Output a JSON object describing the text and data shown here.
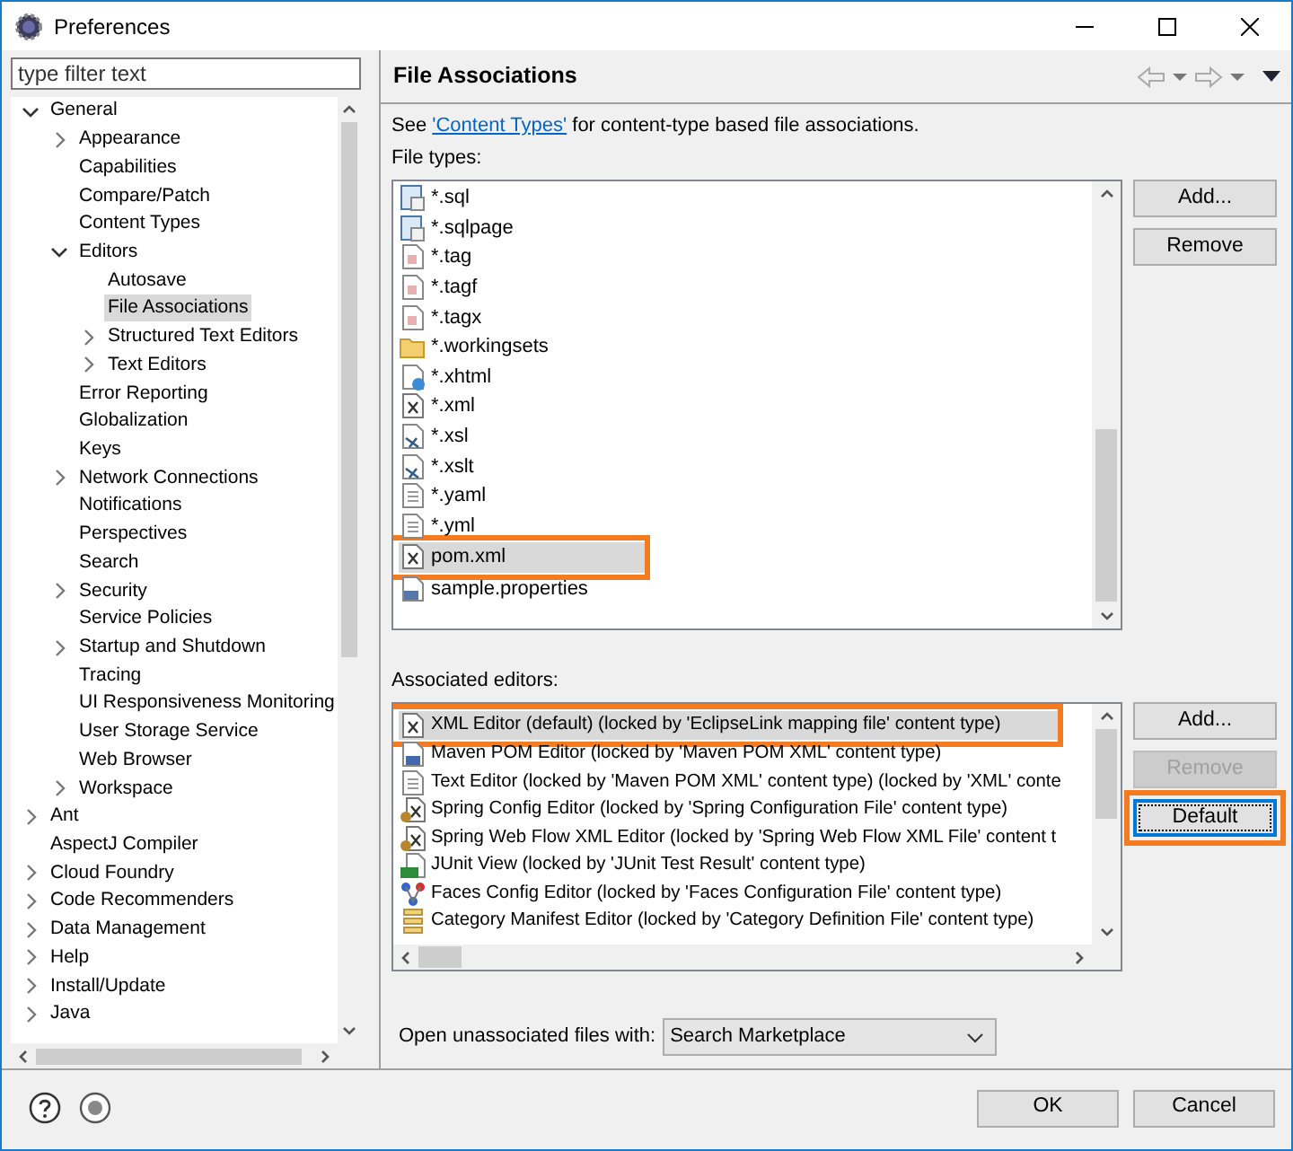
{
  "window": {
    "title": "Preferences"
  },
  "filter": {
    "placeholder": "type filter text"
  },
  "tree": [
    {
      "label": "General",
      "expanded": true,
      "selected": false,
      "children": [
        {
          "label": "Appearance",
          "expanded": false,
          "selected": false
        },
        {
          "label": "Capabilities",
          "selected": false
        },
        {
          "label": "Compare/Patch",
          "selected": false
        },
        {
          "label": "Content Types",
          "selected": false
        },
        {
          "label": "Editors",
          "expanded": true,
          "selected": false,
          "children": [
            {
              "label": "Autosave",
              "selected": false
            },
            {
              "label": "File Associations",
              "selected": true
            },
            {
              "label": "Structured Text Editors",
              "expanded": false,
              "selected": false
            },
            {
              "label": "Text Editors",
              "expanded": false,
              "selected": false
            }
          ]
        },
        {
          "label": "Error Reporting",
          "selected": false
        },
        {
          "label": "Globalization",
          "selected": false
        },
        {
          "label": "Keys",
          "selected": false
        },
        {
          "label": "Network Connections",
          "expanded": false,
          "selected": false
        },
        {
          "label": "Notifications",
          "selected": false
        },
        {
          "label": "Perspectives",
          "selected": false
        },
        {
          "label": "Search",
          "selected": false
        },
        {
          "label": "Security",
          "expanded": false,
          "selected": false
        },
        {
          "label": "Service Policies",
          "selected": false
        },
        {
          "label": "Startup and Shutdown",
          "expanded": false,
          "selected": false
        },
        {
          "label": "Tracing",
          "selected": false
        },
        {
          "label": "UI Responsiveness Monitoring",
          "selected": false
        },
        {
          "label": "User Storage Service",
          "selected": false
        },
        {
          "label": "Web Browser",
          "selected": false
        },
        {
          "label": "Workspace",
          "expanded": false,
          "selected": false
        }
      ]
    },
    {
      "label": "Ant",
      "expanded": false,
      "selected": false
    },
    {
      "label": "AspectJ Compiler",
      "selected": false
    },
    {
      "label": "Cloud Foundry",
      "expanded": false,
      "selected": false
    },
    {
      "label": "Code Recommenders",
      "expanded": false,
      "selected": false
    },
    {
      "label": "Data Management",
      "expanded": false,
      "selected": false
    },
    {
      "label": "Help",
      "expanded": false,
      "selected": false
    },
    {
      "label": "Install/Update",
      "expanded": false,
      "selected": false
    },
    {
      "label": "Java",
      "expanded": false,
      "selected": false
    }
  ],
  "page": {
    "title": "File Associations",
    "intro": {
      "before": "See ",
      "link": "'Content Types'",
      "after": " for content-type based file associations."
    },
    "file_types": {
      "label": "File types:",
      "items": [
        {
          "label": "*.sql",
          "kind": "sql",
          "selected": false,
          "annotated": false
        },
        {
          "label": "*.sqlpage",
          "kind": "sql",
          "selected": false,
          "annotated": false
        },
        {
          "label": "*.tag",
          "kind": "tag",
          "selected": false,
          "annotated": false
        },
        {
          "label": "*.tagf",
          "kind": "tag",
          "selected": false,
          "annotated": false
        },
        {
          "label": "*.tagx",
          "kind": "tag",
          "selected": false,
          "annotated": false
        },
        {
          "label": "*.workingsets",
          "kind": "folder",
          "selected": false,
          "annotated": false
        },
        {
          "label": "*.xhtml",
          "kind": "web",
          "selected": false,
          "annotated": false
        },
        {
          "label": "*.xml",
          "kind": "xml",
          "selected": false,
          "annotated": false
        },
        {
          "label": "*.xsl",
          "kind": "xsl",
          "selected": false,
          "annotated": false
        },
        {
          "label": "*.xslt",
          "kind": "xsl",
          "selected": false,
          "annotated": false
        },
        {
          "label": "*.yaml",
          "kind": "text",
          "selected": false,
          "annotated": false
        },
        {
          "label": "*.yml",
          "kind": "text",
          "selected": false,
          "annotated": false
        },
        {
          "label": "pom.xml",
          "kind": "xml",
          "selected": true,
          "annotated": true
        },
        {
          "label": "sample.properties",
          "kind": "properties",
          "selected": false,
          "annotated": false
        }
      ],
      "buttons": [
        {
          "label": "Add...",
          "disabled": false,
          "focused": false
        },
        {
          "label": "Remove",
          "disabled": false,
          "focused": false
        }
      ]
    },
    "editors": {
      "label": "Associated editors:",
      "items": [
        {
          "label": "XML Editor (default) (locked by 'EclipseLink mapping file' content type)",
          "kind": "xml",
          "selected": true,
          "annotated": true
        },
        {
          "label": "Maven POM Editor (locked by 'Maven POM XML' content type)",
          "kind": "maven",
          "selected": false,
          "annotated": false
        },
        {
          "label": "Text Editor (locked by 'Maven POM XML' content type) (locked by 'XML' conte",
          "kind": "text",
          "selected": false,
          "annotated": false
        },
        {
          "label": "Spring Config Editor (locked by 'Spring Configuration File' content type)",
          "kind": "spring",
          "selected": false,
          "annotated": false
        },
        {
          "label": "Spring Web Flow XML Editor (locked by 'Spring Web Flow XML File' content t",
          "kind": "spring",
          "selected": false,
          "annotated": false
        },
        {
          "label": "JUnit View (locked by 'JUnit Test Result' content type)",
          "kind": "junit",
          "selected": false,
          "annotated": false
        },
        {
          "label": "Faces Config Editor (locked by 'Faces Configuration File' content type)",
          "kind": "faces",
          "selected": false,
          "annotated": false
        },
        {
          "label": "Category Manifest Editor (locked by 'Category Definition File' content type)",
          "kind": "category",
          "selected": false,
          "annotated": false
        }
      ],
      "buttons": [
        {
          "label": "Add...",
          "disabled": false,
          "focused": false
        },
        {
          "label": "Remove",
          "disabled": true,
          "focused": false
        },
        {
          "label": "Default",
          "disabled": false,
          "focused": true,
          "annotated": true
        }
      ]
    },
    "unassociated": {
      "label": "Open unassociated files with:",
      "value": "Search Marketplace"
    }
  },
  "footer_buttons": [
    {
      "label": "OK"
    },
    {
      "label": "Cancel"
    }
  ]
}
